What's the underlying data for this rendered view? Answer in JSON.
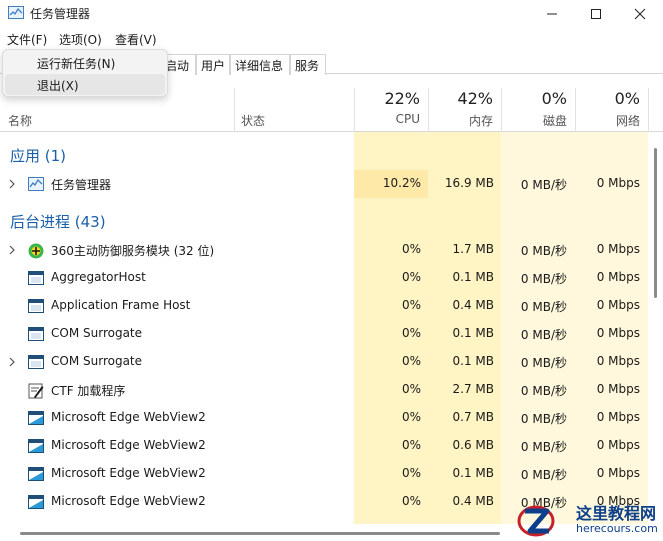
{
  "window": {
    "title": "任务管理器"
  },
  "menubar": [
    {
      "label": "文件(F)"
    },
    {
      "label": "选项(O)"
    },
    {
      "label": "查看(V)"
    }
  ],
  "file_menu": [
    {
      "label": "运行新任务(N)"
    },
    {
      "label": "退出(X)"
    }
  ],
  "tabs": [
    {
      "label": "启动"
    },
    {
      "label": "用户"
    },
    {
      "label": "详细信息"
    },
    {
      "label": "服务"
    }
  ],
  "columns": {
    "name": "名称",
    "status": "状态",
    "cpu": {
      "pct": "22%",
      "label": "CPU"
    },
    "mem": {
      "pct": "42%",
      "label": "内存"
    },
    "disk": {
      "pct": "0%",
      "label": "磁盘"
    },
    "net": {
      "pct": "0%",
      "label": "网络"
    }
  },
  "groups": {
    "apps": "应用 (1)",
    "background": "后台进程 (43)"
  },
  "app_rows": [
    {
      "name": "任务管理器",
      "icon": "task-manager-icon",
      "expandable": true,
      "cpu": "10.2%",
      "mem": "16.9 MB",
      "disk": "0 MB/秒",
      "net": "0 Mbps"
    }
  ],
  "bg_rows": [
    {
      "name": "360主动防御服务模块 (32 位)",
      "icon": "360-shield-icon",
      "expandable": true,
      "cpu": "0%",
      "mem": "1.7 MB",
      "disk": "0 MB/秒",
      "net": "0 Mbps"
    },
    {
      "name": "AggregatorHost",
      "icon": "window-process-icon",
      "expandable": false,
      "cpu": "0%",
      "mem": "0.1 MB",
      "disk": "0 MB/秒",
      "net": "0 Mbps"
    },
    {
      "name": "Application Frame Host",
      "icon": "window-process-icon",
      "expandable": false,
      "cpu": "0%",
      "mem": "0.4 MB",
      "disk": "0 MB/秒",
      "net": "0 Mbps"
    },
    {
      "name": "COM Surrogate",
      "icon": "window-process-icon",
      "expandable": false,
      "cpu": "0%",
      "mem": "0.1 MB",
      "disk": "0 MB/秒",
      "net": "0 Mbps"
    },
    {
      "name": "COM Surrogate",
      "icon": "window-process-icon",
      "expandable": true,
      "cpu": "0%",
      "mem": "0.1 MB",
      "disk": "0 MB/秒",
      "net": "0 Mbps"
    },
    {
      "name": "CTF 加载程序",
      "icon": "ctf-pen-icon",
      "expandable": false,
      "cpu": "0%",
      "mem": "2.7 MB",
      "disk": "0 MB/秒",
      "net": "0 Mbps"
    },
    {
      "name": "Microsoft Edge WebView2",
      "icon": "webview-icon",
      "expandable": false,
      "cpu": "0%",
      "mem": "0.7 MB",
      "disk": "0 MB/秒",
      "net": "0 Mbps"
    },
    {
      "name": "Microsoft Edge WebView2",
      "icon": "webview-icon",
      "expandable": false,
      "cpu": "0%",
      "mem": "0.6 MB",
      "disk": "0 MB/秒",
      "net": "0 Mbps"
    },
    {
      "name": "Microsoft Edge WebView2",
      "icon": "webview-icon",
      "expandable": false,
      "cpu": "0%",
      "mem": "0.1 MB",
      "disk": "0 MB/秒",
      "net": "0 Mbps"
    },
    {
      "name": "Microsoft Edge WebView2",
      "icon": "webview-icon",
      "expandable": false,
      "cpu": "0%",
      "mem": "0.4 MB",
      "disk": "0 MB/秒",
      "net": "0 Mbps"
    }
  ],
  "colors": {
    "group_title": "#1a5fa8",
    "heat_light": "#fff8dc",
    "heat_mid": "#fff4c4",
    "heat_hot": "#ffe9a8"
  },
  "watermark": {
    "cn": "这里教程网",
    "en": "herecours.com"
  }
}
